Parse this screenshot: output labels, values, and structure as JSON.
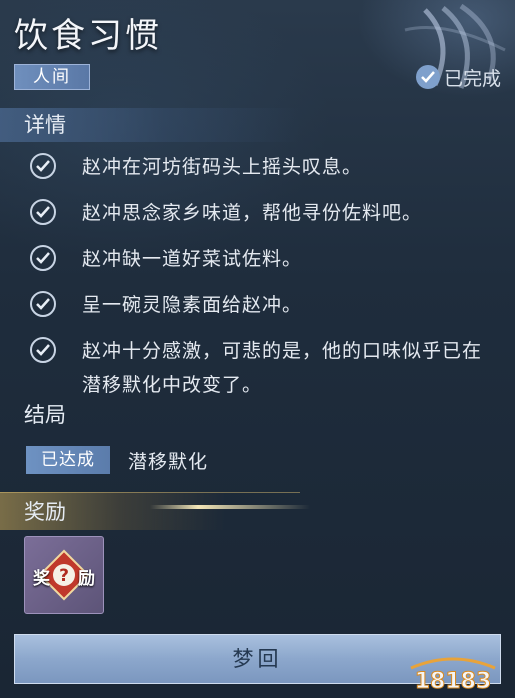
{
  "quest": {
    "title": "饮食习惯",
    "realm_tag": "人间",
    "status_label": "已完成"
  },
  "details": {
    "heading": "详情",
    "items": [
      "赵冲在河坊街码头上摇头叹息。",
      "赵冲思念家乡味道，帮他寻份佐料吧。",
      "赵冲缺一道好菜试佐料。",
      "呈一碗灵隐素面给赵冲。",
      "赵冲十分感激，可悲的是，他的口味似乎已在潜移默化中改变了。"
    ]
  },
  "ending": {
    "heading": "结局",
    "badge": "已达成",
    "name": "潜移默化"
  },
  "reward": {
    "heading": "奖励",
    "icon_left": "奖",
    "icon_right": "励",
    "icon_mark": "?"
  },
  "actions": {
    "dream_button": "梦回"
  },
  "watermark": {
    "text": "18183"
  },
  "colors": {
    "accent_blue": "#6f8fbd",
    "reward_gold": "#aa9150",
    "reward_icon_red": "#c0392b"
  }
}
